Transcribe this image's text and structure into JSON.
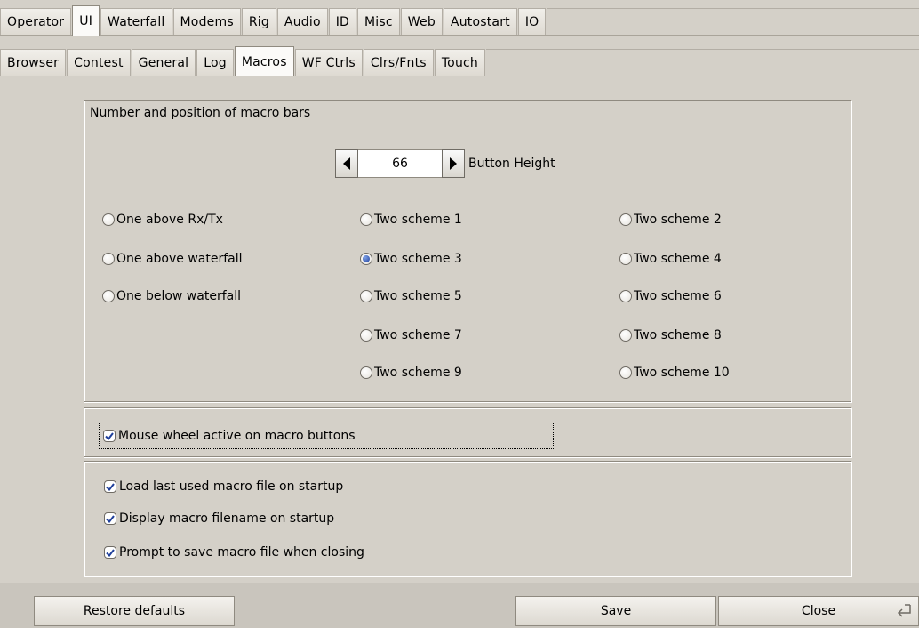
{
  "tabs_row1": [
    {
      "label": "Operator"
    },
    {
      "label": "UI"
    },
    {
      "label": "Waterfall"
    },
    {
      "label": "Modems"
    },
    {
      "label": "Rig"
    },
    {
      "label": "Audio"
    },
    {
      "label": "ID"
    },
    {
      "label": "Misc"
    },
    {
      "label": "Web"
    },
    {
      "label": "Autostart"
    },
    {
      "label": "IO"
    }
  ],
  "tabs_row1_active": "UI",
  "tabs_row2": [
    {
      "label": "Browser"
    },
    {
      "label": "Contest"
    },
    {
      "label": "General"
    },
    {
      "label": "Log"
    },
    {
      "label": "Macros"
    },
    {
      "label": "WF Ctrls"
    },
    {
      "label": "Clrs/Fnts"
    },
    {
      "label": "Touch"
    }
  ],
  "tabs_row2_active": "Macros",
  "macro_bars": {
    "title": "Number and position of macro bars",
    "button_height": {
      "value": "66",
      "label": "Button Height"
    },
    "options": [
      {
        "label": "One above Rx/Tx",
        "selected": false
      },
      {
        "label": "Two scheme 1",
        "selected": false
      },
      {
        "label": "Two scheme 2",
        "selected": false
      },
      {
        "label": "One above waterfall",
        "selected": false
      },
      {
        "label": "Two scheme 3",
        "selected": true
      },
      {
        "label": "Two scheme 4",
        "selected": false
      },
      {
        "label": "One below waterfall",
        "selected": false
      },
      {
        "label": "Two scheme 5",
        "selected": false
      },
      {
        "label": "Two scheme 6",
        "selected": false
      },
      {
        "label": "Two scheme 7",
        "selected": false
      },
      {
        "label": "Two scheme 8",
        "selected": false
      },
      {
        "label": "Two scheme 9",
        "selected": false
      },
      {
        "label": "Two scheme 10",
        "selected": false
      }
    ]
  },
  "mouse_wheel": {
    "label": "Mouse wheel active on macro buttons",
    "checked": true
  },
  "file_options": [
    {
      "label": "Load last used macro file on startup",
      "checked": true
    },
    {
      "label": "Display macro filename on startup",
      "checked": true
    },
    {
      "label": "Prompt to save macro file when closing",
      "checked": true
    }
  ],
  "buttons": {
    "restore": "Restore defaults",
    "save": "Save",
    "close": "Close"
  },
  "icons": {
    "increment": "right-arrow-icon",
    "decrement": "left-arrow-icon",
    "enter": "enter-key-icon"
  }
}
